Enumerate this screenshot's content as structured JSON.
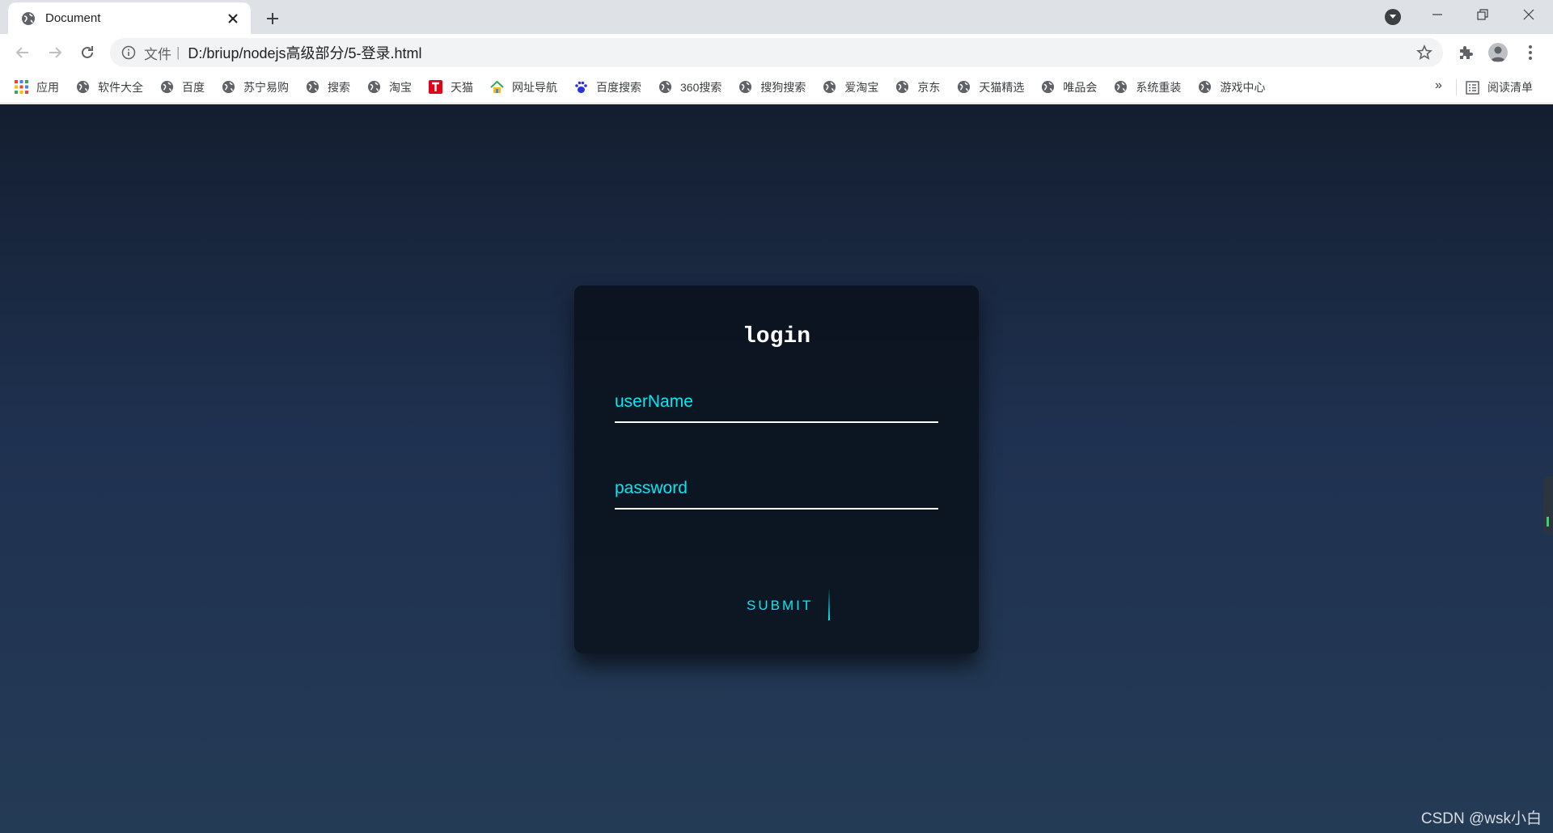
{
  "browser": {
    "tab": {
      "title": "Document",
      "favicon": "globe-icon"
    },
    "address_bar": {
      "scheme_label": "文件",
      "url": "D:/briup/nodejs高级部分/5-登录.html"
    },
    "bookmarks": [
      {
        "label": "应用",
        "icon": "apps-grid-icon"
      },
      {
        "label": "软件大全",
        "icon": "globe-icon"
      },
      {
        "label": "百度",
        "icon": "globe-icon"
      },
      {
        "label": "苏宁易购",
        "icon": "globe-icon"
      },
      {
        "label": "搜索",
        "icon": "globe-icon"
      },
      {
        "label": "淘宝",
        "icon": "globe-icon"
      },
      {
        "label": "天猫",
        "icon": "tmall-icon"
      },
      {
        "label": "网址导航",
        "icon": "house-icon"
      },
      {
        "label": "百度搜索",
        "icon": "paw-icon"
      },
      {
        "label": "360搜索",
        "icon": "globe-icon"
      },
      {
        "label": "搜狗搜索",
        "icon": "globe-icon"
      },
      {
        "label": "爱淘宝",
        "icon": "globe-icon"
      },
      {
        "label": "京东",
        "icon": "globe-icon"
      },
      {
        "label": "天猫精选",
        "icon": "globe-icon"
      },
      {
        "label": "唯品会",
        "icon": "globe-icon"
      },
      {
        "label": "系统重装",
        "icon": "globe-icon"
      },
      {
        "label": "游戏中心",
        "icon": "globe-icon"
      }
    ],
    "bookmarks_more": "»",
    "reading_list": "阅读清单"
  },
  "login": {
    "title": "login",
    "username_label": "userName",
    "password_label": "password",
    "submit_label": "SUBMIT"
  },
  "watermark": "CSDN @wsk小白",
  "colors": {
    "accent": "#03e9f4",
    "background_top": "#141e30",
    "background_bottom": "#243b55"
  }
}
